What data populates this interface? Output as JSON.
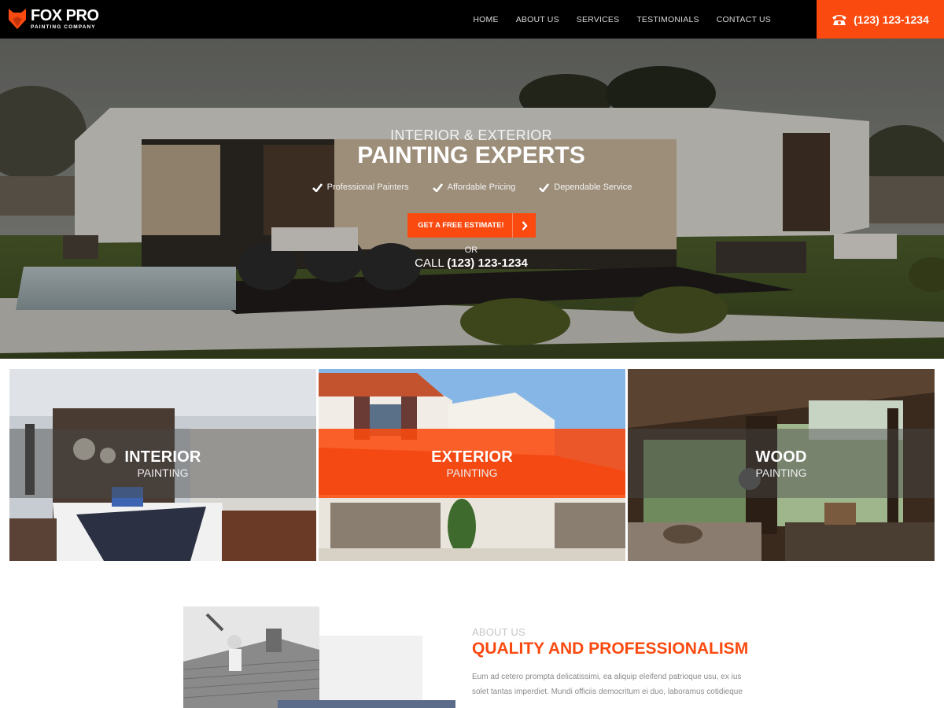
{
  "brand": {
    "name": "FOX PRO",
    "tagline": "PAINTING COMPANY",
    "accent_color": "#fa4a0f"
  },
  "nav": {
    "items": [
      {
        "label": "HOME"
      },
      {
        "label": "ABOUT US"
      },
      {
        "label": "SERVICES"
      },
      {
        "label": "TESTIMONIALS"
      },
      {
        "label": "CONTACT US"
      }
    ],
    "phone": "(123) 123-1234",
    "phone_icon": "telephone-icon"
  },
  "hero": {
    "subtitle": "INTERIOR & EXTERIOR",
    "title": "PAINTING EXPERTS",
    "features": [
      {
        "label": "Professional Painters",
        "icon": "checkmark-icon"
      },
      {
        "label": "Affordable Pricing",
        "icon": "checkmark-icon"
      },
      {
        "label": "Dependable Service",
        "icon": "checkmark-icon"
      }
    ],
    "cta_label": "GET A FREE ESTIMATE!",
    "cta_icon": "chevron-right-icon",
    "or_text": "OR",
    "call_prefix": "CALL",
    "call_number": "(123) 123-1234"
  },
  "services": [
    {
      "title": "INTERIOR",
      "subtitle": "PAINTING",
      "highlight": false
    },
    {
      "title": "EXTERIOR",
      "subtitle": "PAINTING",
      "highlight": true
    },
    {
      "title": "WOOD",
      "subtitle": "PAINTING",
      "highlight": false
    }
  ],
  "about": {
    "kicker": "ABOUT US",
    "title": "QUALITY AND PROFESSIONALISM",
    "body": "Eum ad cetero prompta delicatissimi, ea aliquip eleifend patrioque usu, ex ius solet tantas imperdiet. Mundi officiis democritum ei duo, laboramus cotidieque"
  }
}
